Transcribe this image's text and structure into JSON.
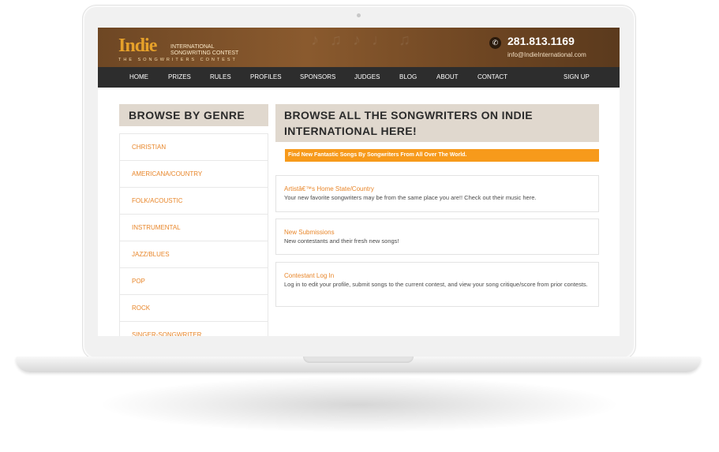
{
  "site": {
    "logo_word": "Indie",
    "logo_line1": "INTERNATIONAL",
    "logo_line2": "SONGWRITING CONTEST",
    "logo_tagline": "THE SONGWRITERS CONTEST",
    "phone": "281.813.1169",
    "email": "info@IndieInternational.com",
    "phone_icon": "phone-icon"
  },
  "nav": {
    "items": [
      "HOME",
      "PRIZES",
      "RULES",
      "PROFILES",
      "SPONSORS",
      "JUDGES",
      "BLOG",
      "ABOUT",
      "CONTACT"
    ],
    "signup": "SIGN UP"
  },
  "sidebar": {
    "title": "BROWSE BY GENRE",
    "genres": [
      "CHRISTIAN",
      "AMERICANA/COUNTRY",
      "FOLK/ACOUSTIC",
      "INSTRUMENTAL",
      "JAZZ/BLUES",
      "POP",
      "ROCK",
      "SINGER-SONGWRITER"
    ]
  },
  "main": {
    "title_line1": "BROWSE ALL THE SONGWRITERS ON INDIE",
    "title_line2": "INTERNATIONAL HERE!",
    "promo": "Find New Fantastic Songs By Songwriters From All Over The World.",
    "cards": [
      {
        "title": "Artistâ€™s Home State/Country",
        "desc": "Your new favorite songwriters may be from the same place you are!! Check out their music here."
      },
      {
        "title": "New Submissions",
        "desc": "New contestants and their fresh new songs!"
      },
      {
        "title": "Contestant Log In",
        "desc": "Log in to edit your profile, submit songs to the current contest, and view your song critique/score from prior contests."
      }
    ]
  },
  "colors": {
    "accent": "#f79a1b",
    "link": "#e8862a",
    "header": "#7a4f27",
    "nav": "#2d2d2d",
    "panel": "#e0d8ce"
  }
}
